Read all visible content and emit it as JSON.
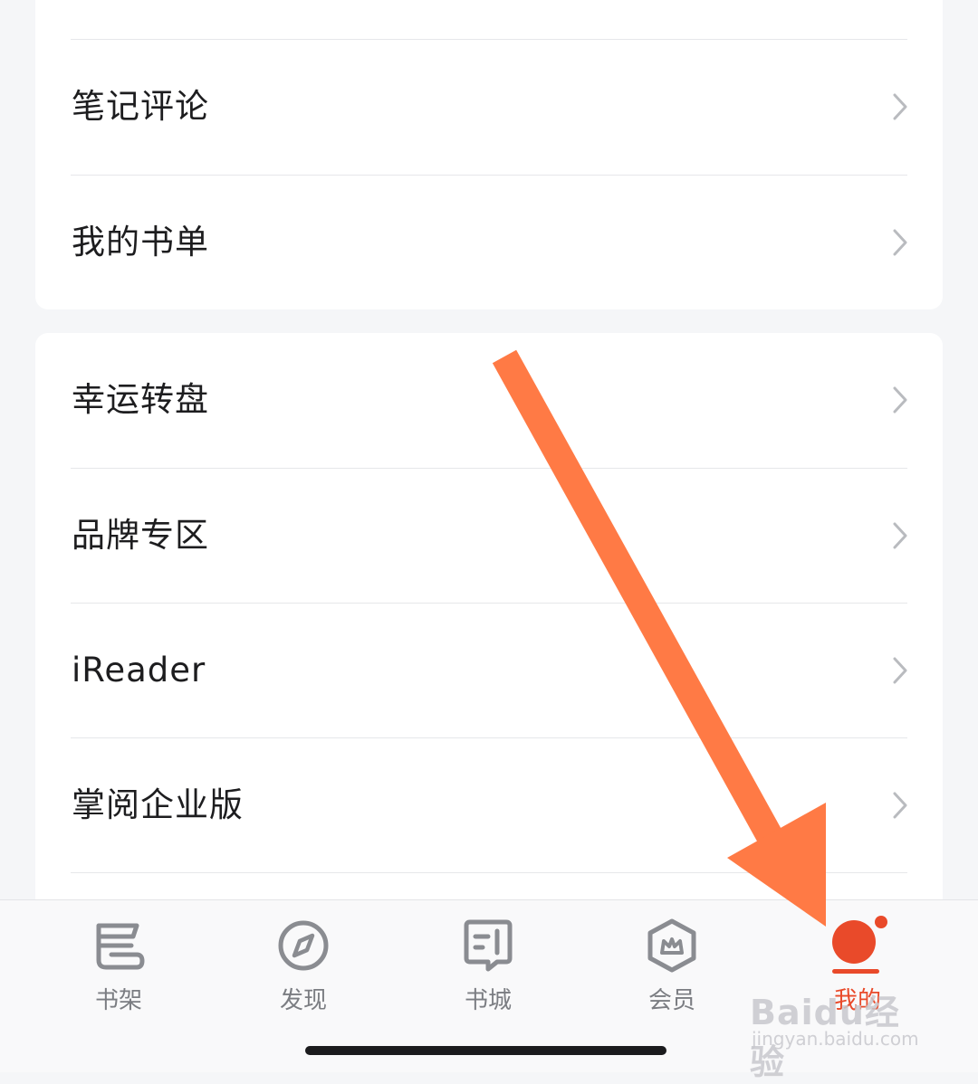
{
  "menu_group_1": [
    {
      "label": "笔记评论"
    },
    {
      "label": "我的书单"
    }
  ],
  "menu_group_2": [
    {
      "label": "幸运转盘"
    },
    {
      "label": "品牌专区"
    },
    {
      "label": "iReader"
    },
    {
      "label": "掌阅企业版"
    }
  ],
  "tabbar": {
    "tabs": [
      {
        "label": "书架",
        "icon": "bookshelf-icon"
      },
      {
        "label": "发现",
        "icon": "compass-icon"
      },
      {
        "label": "书城",
        "icon": "bookstore-icon"
      },
      {
        "label": "会员",
        "icon": "crown-hexagon-icon"
      },
      {
        "label": "我的",
        "icon": "profile-icon",
        "active": true
      }
    ]
  },
  "colors": {
    "accent": "#e94a2a",
    "arrow": "#ff7a45",
    "text": "#1d1d1f",
    "tab_inactive": "#7b7d82"
  },
  "watermark": {
    "main": "Baidu经验",
    "sub": "jingyan.baidu.com"
  }
}
